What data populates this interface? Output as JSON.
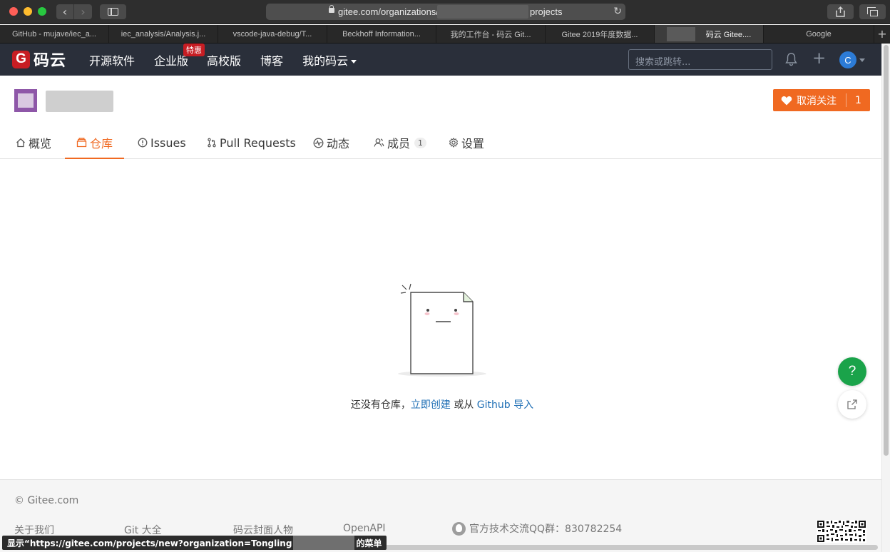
{
  "browser": {
    "url_prefix": "gitee.com/organizations/",
    "url_suffix": "projects",
    "tabs": [
      {
        "title": "GitHub - mujave/iec_a..."
      },
      {
        "title": "iec_analysis/Analysis.j..."
      },
      {
        "title": "vscode-java-debug/T..."
      },
      {
        "title": "Beckhoff Information..."
      },
      {
        "title": "我的工作台 - 码云 Git..."
      },
      {
        "title": "Gitee 2019年度数据..."
      },
      {
        "title": "码云 Gitee...."
      },
      {
        "title": "Google"
      }
    ],
    "status_prefix": "显示“https://gitee.com/projects/new?organization=Tongling",
    "status_suffix": "的菜单"
  },
  "header": {
    "logo_mark": "G",
    "logo_text": "码云",
    "nav": {
      "open_source": "开源软件",
      "enterprise": "企业版",
      "enterprise_badge": "特惠",
      "education": "高校版",
      "blog": "博客",
      "my_gitee": "我的码云"
    },
    "search_placeholder": "搜索或跳转...",
    "avatar_letter": "C",
    "colors": {
      "header_bg": "#2a2f3a",
      "brand_red": "#c71d23",
      "accent_orange": "#f06921"
    }
  },
  "org": {
    "unfollow_label": "取消关注",
    "follower_count": "1"
  },
  "tabs": {
    "overview": "概览",
    "repos": "仓库",
    "issues": "Issues",
    "pull_requests": "Pull Requests",
    "activity": "动态",
    "members": "成员",
    "members_count": "1",
    "settings": "设置"
  },
  "empty": {
    "text_prefix": "还没有仓库，",
    "create_link": "立即创建",
    "text_middle": " 或从 ",
    "import_link": "Github 导入"
  },
  "float": {
    "help_symbol": "?"
  },
  "footer": {
    "copyright": "© Gitee.com",
    "links": {
      "about": "关于我们",
      "git_guide": "Git 大全",
      "cover_people": "码云封面人物",
      "openapi": "OpenAPI"
    },
    "qq_group": "官方技术交流QQ群：830782254"
  }
}
